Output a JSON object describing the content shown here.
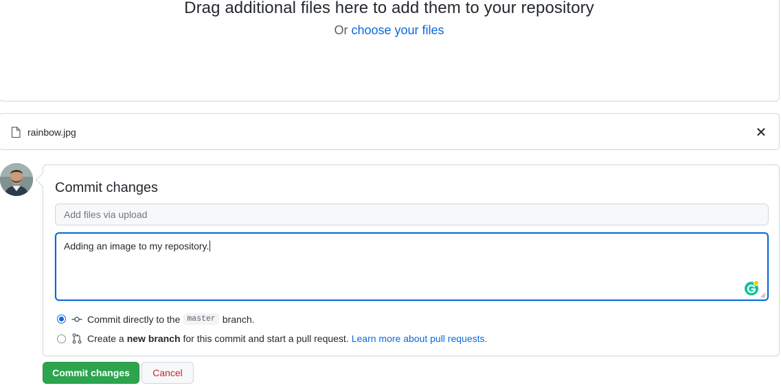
{
  "dropzone": {
    "title": "Drag additional files here to add them to your repository",
    "prefix": "Or",
    "choose_link": "choose your files"
  },
  "file": {
    "name": "rainbow.jpg",
    "icon": "file-icon",
    "close_icon": "close-icon"
  },
  "commit": {
    "heading": "Commit changes",
    "summary_placeholder": "Add files via upload",
    "summary_value": "",
    "description_value": "Adding an image to my repository.",
    "options": [
      {
        "selected": true,
        "before": "Commit directly to the",
        "branch": "master",
        "after": "branch."
      },
      {
        "selected": false,
        "before": "Create a",
        "bold": "new branch",
        "after": "for this commit and start a pull request.",
        "link": "Learn more about pull requests."
      }
    ]
  },
  "buttons": {
    "commit_label": "Commit changes",
    "cancel_label": "Cancel"
  },
  "colors": {
    "accent": "#0969da",
    "primary_button": "#2da44e",
    "danger_text": "#cf222e",
    "border": "#d0d7de"
  }
}
